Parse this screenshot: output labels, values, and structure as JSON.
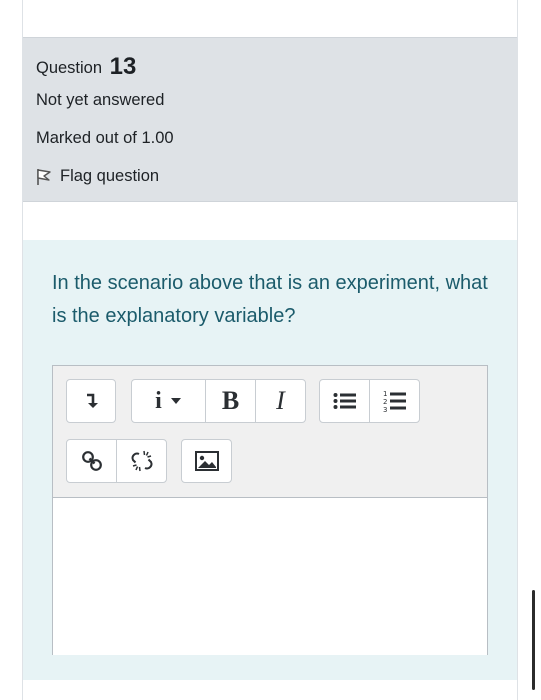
{
  "question": {
    "label": "Question",
    "number": "13",
    "state": "Not yet answered",
    "mark": "Marked out of 1.00",
    "flag_label": "Flag question",
    "text": "In the scenario above that is an experiment, what is the explanatory variable?"
  },
  "toolbar": {
    "collapse_icon": "arrow-down-icon",
    "info_glyph": "i",
    "bold_glyph": "B",
    "italic_glyph": "I",
    "buttons": [
      "collapse-toggle",
      "paragraph-style",
      "bold",
      "italic",
      "unordered-list",
      "ordered-list",
      "link",
      "unlink",
      "image"
    ]
  },
  "editor": {
    "value": ""
  },
  "colors": {
    "info_bg": "#dee2e6",
    "content_bg": "#e7f3f5",
    "question_text": "#1b5b6b"
  }
}
